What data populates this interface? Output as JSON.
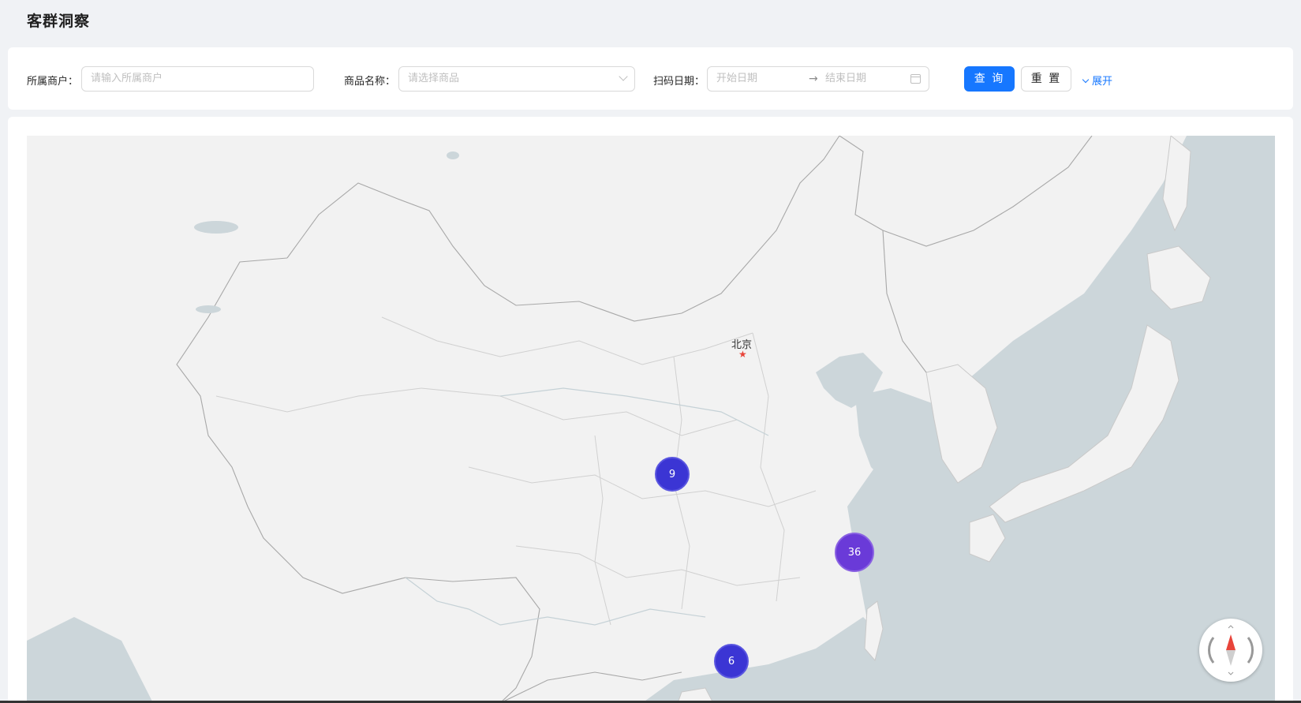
{
  "page": {
    "title": "客群洞察"
  },
  "filters": {
    "merchant_label": "所属商户：",
    "merchant_placeholder": "请输入所属商户",
    "product_label": "商品名称：",
    "product_placeholder": "请选择商品",
    "date_label": "扫码日期：",
    "date_start_placeholder": "开始日期",
    "date_separator": "→",
    "date_end_placeholder": "结束日期",
    "query_button": "查 询",
    "reset_button": "重 置",
    "expand_link": "展开"
  },
  "map": {
    "capital_label": "北京",
    "clusters": [
      {
        "count": "9",
        "color": "#3b35d4"
      },
      {
        "count": "36",
        "color": "#6a3ad8"
      },
      {
        "count": "6",
        "color": "#3b35d4"
      }
    ],
    "colors": {
      "land": "#f2f2f2",
      "sea": "#ccd6da",
      "border": "#b8b8b8",
      "capital_star": "#e8443a"
    }
  }
}
